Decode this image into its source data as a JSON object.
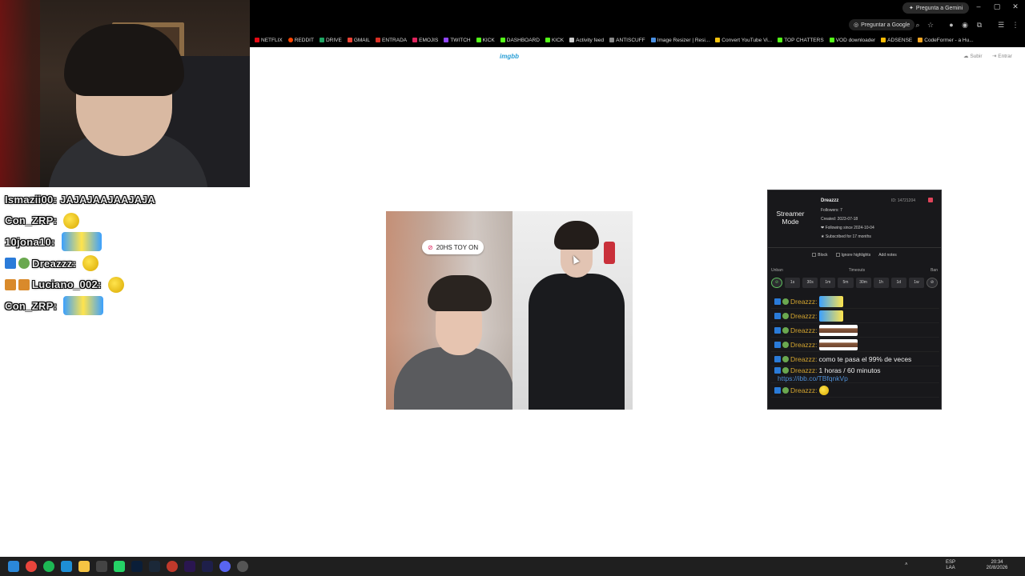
{
  "stream_chat": [
    {
      "user": "Ismazii00:",
      "text": "JAJAJAAJAAJAJA"
    },
    {
      "user": "Con_ZRP:",
      "text": ""
    },
    {
      "user": "10jona10:",
      "text": ""
    },
    {
      "user": "Dreazzz:",
      "text": ""
    },
    {
      "user": "Luciano_002:",
      "text": ""
    },
    {
      "user": "Con_ZRP:",
      "text": ""
    }
  ],
  "browser": {
    "gemini_label": "Pregunta a Gemini",
    "google_label": "Preguntar a Google",
    "bookmarks": [
      {
        "label": "NETFLIX",
        "color": "#e50914"
      },
      {
        "label": "REDDIT",
        "color": "#ff4500"
      },
      {
        "label": "DRIVE",
        "color": "#1fa463"
      },
      {
        "label": "GMAIL",
        "color": "#ea4335"
      },
      {
        "label": "ENTRADA",
        "color": "#d93025"
      },
      {
        "label": "EMOJIS",
        "color": "#e0245e"
      },
      {
        "label": "TWITCH",
        "color": "#9146ff"
      },
      {
        "label": "KICK",
        "color": "#53fc18"
      },
      {
        "label": "DASHBOARD",
        "color": "#53fc18"
      },
      {
        "label": "KICK",
        "color": "#53fc18"
      },
      {
        "label": "Activity feed",
        "color": "#cccccc"
      },
      {
        "label": "ANTISCUFF",
        "color": "#888888"
      },
      {
        "label": "Image Resizer | Resi...",
        "color": "#4a90e2"
      },
      {
        "label": "Convert YouTube Vi...",
        "color": "#f4c20d"
      },
      {
        "label": "TOP CHATTERS",
        "color": "#53fc18"
      },
      {
        "label": "VOD downloader",
        "color": "#53fc18"
      },
      {
        "label": "ADSENSE",
        "color": "#fbbc04"
      },
      {
        "label": "CodeFormer - a Hu...",
        "color": "#f5a623"
      }
    ]
  },
  "page": {
    "logo": "imgbb",
    "upload": "Subir",
    "login": "Entrar",
    "photo_tag": "20HS TOY ON"
  },
  "usercard": {
    "mode_label": "Streamer Mode",
    "name": "Dreazzz",
    "id": "ID: 14721204",
    "followers": "Followers: 7",
    "created": "Created: 2023-07-18",
    "following": "❤ Following since 2024-10-04",
    "subscribed": "★ Subscribed for 17 months",
    "block": "Block",
    "ignore": "Ignore highlights",
    "notes": "Add notes",
    "unban": "Unban",
    "timeouts": "Timeouts",
    "ban": "Ban",
    "timeout_buttons": [
      "1s",
      "30s",
      "1m",
      "5m",
      "30m",
      "1h",
      "1d",
      "1w"
    ],
    "messages": [
      {
        "user": "Dreazzz:",
        "text": "",
        "emote": "minion"
      },
      {
        "user": "Dreazzz:",
        "text": "",
        "emote": "minion"
      },
      {
        "user": "Dreazzz:",
        "text": "",
        "emote": "table"
      },
      {
        "user": "Dreazzz:",
        "text": "",
        "emote": "table"
      },
      {
        "user": "Dreazzz:",
        "text": "como te pasa el 99% de veces",
        "emote": ""
      },
      {
        "user": "Dreazzz:",
        "text": "1 horas / 60 minutos",
        "emote": "",
        "link": "https://ibb.co/TBfqnkVp"
      },
      {
        "user": "Dreazzz:",
        "text": "",
        "emote": "smile"
      }
    ]
  },
  "taskbar": {
    "lang": "ESP",
    "lang2": "LAA",
    "time": "20:34",
    "date": "20/8/2026"
  }
}
